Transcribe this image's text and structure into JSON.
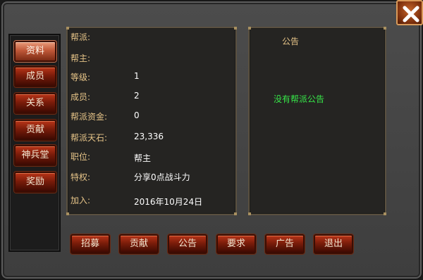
{
  "sidebar": {
    "items": [
      {
        "label": "资料",
        "active": true
      },
      {
        "label": "成员",
        "active": false
      },
      {
        "label": "关系",
        "active": false
      },
      {
        "label": "贡献",
        "active": false
      },
      {
        "label": "神兵堂",
        "active": false
      },
      {
        "label": "奖励",
        "active": false
      }
    ]
  },
  "info": {
    "rows": [
      {
        "label": "帮派:",
        "value": ""
      },
      {
        "label": "帮主:",
        "value": ""
      },
      {
        "label": "等级:",
        "value": "1"
      },
      {
        "label": "成员:",
        "value": "2"
      },
      {
        "label": "帮派资金:",
        "value": "0"
      },
      {
        "label": "帮派天石:",
        "value": "23,336"
      },
      {
        "label": "职位:",
        "value": "帮主"
      },
      {
        "label": "特权:",
        "value": "分享0点战斗力"
      },
      {
        "label": "加入:",
        "value": "2016年10月24日"
      }
    ]
  },
  "notice": {
    "title": "公告",
    "text": "没有帮派公告"
  },
  "actions": {
    "buttons": [
      "招募",
      "贡献",
      "公告",
      "要求",
      "广告",
      "退出"
    ]
  },
  "colors": {
    "label": "#e6c488",
    "value": "#ffffff",
    "notice_text": "#36e648",
    "button_red": "#7a1c0a"
  },
  "icons": {
    "close": "close-icon"
  }
}
